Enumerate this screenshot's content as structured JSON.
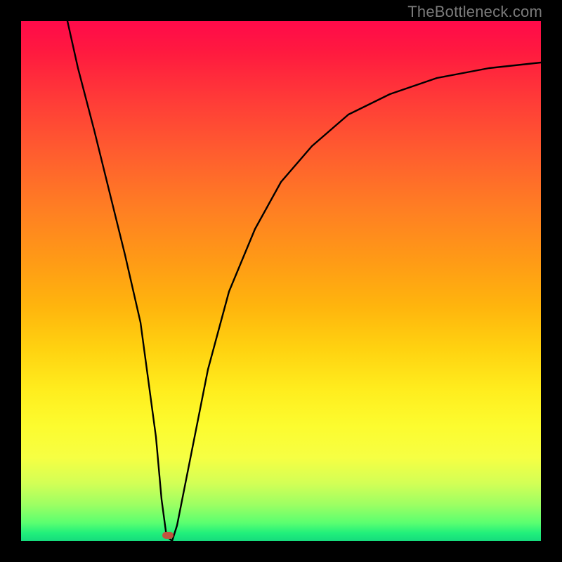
{
  "watermark": "TheBottleneck.com",
  "colors": {
    "frame": "#000000",
    "gradient_top": "#ff0a4a",
    "gradient_bottom": "#16db7c",
    "curve": "#000000",
    "marker": "#c1553f",
    "watermark_text": "#7a7a7a"
  },
  "chart_data": {
    "type": "line",
    "title": "",
    "xlabel": "",
    "ylabel": "",
    "xlim": [
      0,
      100
    ],
    "ylim": [
      0,
      100
    ],
    "grid": false,
    "legend": false,
    "note": "x and y in percent of plot area; y=0 at bottom, y=100 at top. Values estimated from pixels.",
    "series": [
      {
        "name": "curve",
        "x": [
          9,
          11,
          14,
          17,
          20,
          23,
          26,
          27,
          28,
          29,
          30,
          33,
          36,
          40,
          45,
          50,
          56,
          63,
          71,
          80,
          90,
          100
        ],
        "y": [
          100,
          91,
          79,
          67,
          55,
          42,
          20,
          8,
          1,
          0,
          3,
          18,
          33,
          48,
          60,
          69,
          76,
          82,
          86,
          89,
          91,
          92
        ]
      }
    ],
    "marker": {
      "x": 28.3,
      "y": 0.5
    }
  }
}
